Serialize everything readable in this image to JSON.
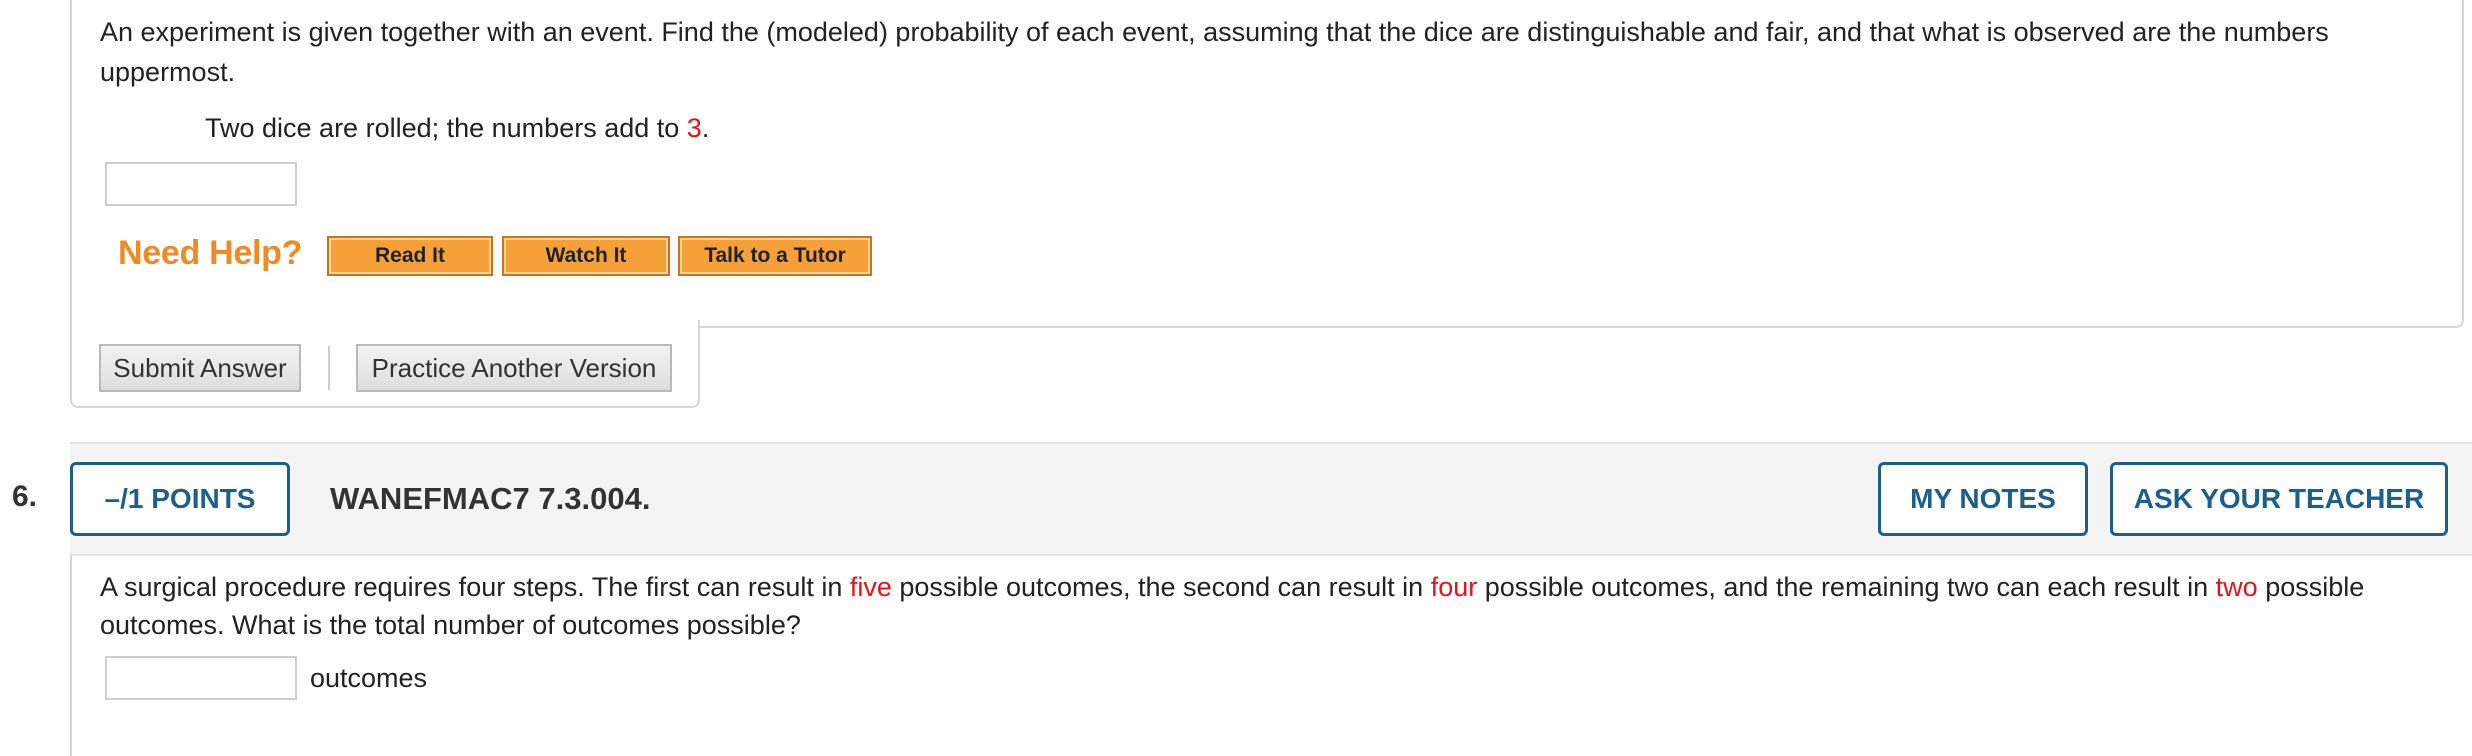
{
  "q5": {
    "prompt": "An experiment is given together with an event. Find the (modeled) probability of each event, assuming that the dice are distinguishable and fair, and that what is observed are the numbers uppermost.",
    "event_prefix": "Two dice are rolled; the numbers add to ",
    "event_value": "3",
    "event_suffix": ".",
    "answer_value": "",
    "need_help": "Need Help?",
    "help_buttons": [
      "Read It",
      "Watch It",
      "Talk to a Tutor"
    ],
    "submit_label": "Submit Answer",
    "practice_label": "Practice Another Version"
  },
  "q6": {
    "number": "6.",
    "points": "–/1 POINTS",
    "id": "WANEFMAC7 7.3.004.",
    "notes_label": "MY NOTES",
    "ask_label": "ASK YOUR TEACHER",
    "text_parts": [
      "A surgical procedure requires four steps. The first can result in ",
      "five",
      " possible outcomes, the second can result in ",
      "four",
      " possible outcomes, and the remaining two can each result in ",
      "two",
      " possible outcomes. What is the total number of outcomes possible?"
    ],
    "answer_value": "",
    "unit": "outcomes"
  },
  "colors": {
    "highlight_red": "#e8101a",
    "help_orange": "#f08a24",
    "link_blue": "#1d5f8c"
  }
}
